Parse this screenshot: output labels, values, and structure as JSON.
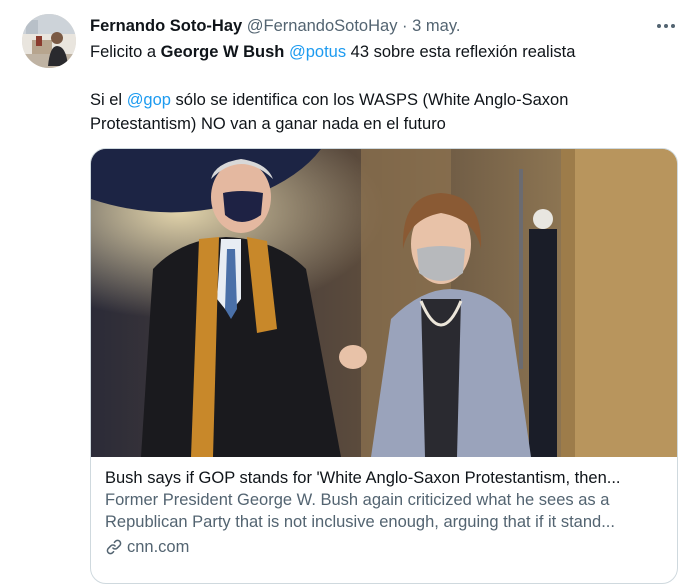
{
  "tweet": {
    "author_name": "Fernando Soto-Hay",
    "handle": "@FernandoSotoHay",
    "separator": "·",
    "date": "3 may.",
    "more_icon": "more-horizontal-icon",
    "line1": {
      "prefix": "Felicito a ",
      "bold": "George W Bush",
      "space": " ",
      "mention": "@potus",
      "suffix": " 43 sobre esta reflexión realista"
    },
    "line2": {
      "prefix": "Si el ",
      "mention": "@gop",
      "suffix": " sólo se identifica con los WASPS (White Anglo-Saxon Protestantism) NO van a ganar nada en el futuro"
    }
  },
  "card": {
    "title": "Bush says if GOP stands for 'White Anglo-Saxon Protestantism, then...",
    "description_line1": "Former President George W. Bush again criticized what he sees as a",
    "description_line2": "Republican Party that is not inclusive enough, arguing that if it stand...",
    "domain": "cnn.com",
    "domain_icon": "link-icon"
  },
  "colors": {
    "accent": "#1d9bf0",
    "text": "#0f1419",
    "muted": "#536471",
    "border": "#cfd9de"
  }
}
